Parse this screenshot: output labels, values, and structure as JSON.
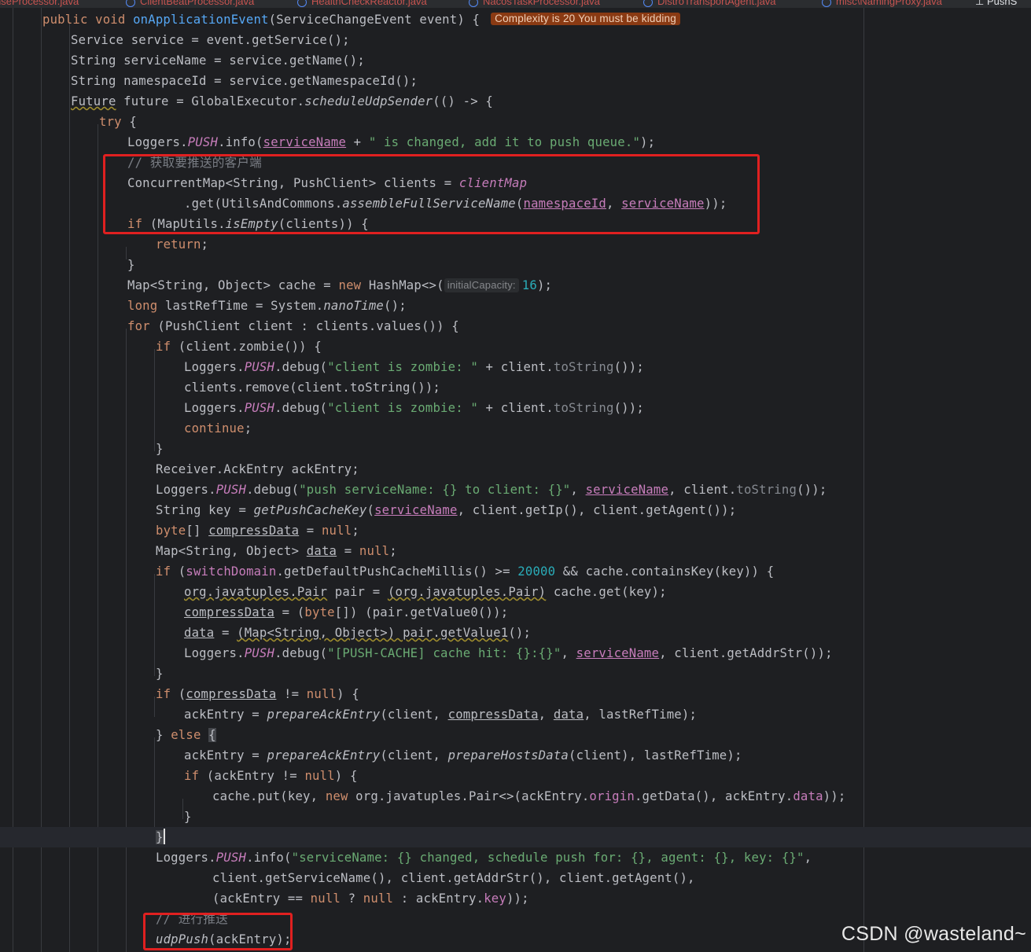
{
  "tabs": [
    {
      "label": "nseProcessor.java"
    },
    {
      "label": "ClientBeatProcessor.java"
    },
    {
      "label": "HealthCheckReactor.java"
    },
    {
      "label": "NacosTaskProcessor.java"
    },
    {
      "label": "DistroTransportAgent.java"
    },
    {
      "label": "misc\\NamingProxy.java"
    },
    {
      "label": "PushS"
    }
  ],
  "complexity_badge": "Complexity is 20 You must be kidding",
  "param_hint": "initialCapacity:",
  "comments": {
    "get_clients": "// 获取要推送的客户端",
    "do_push": "// 进行推送"
  },
  "watermark": "CSDN @wasteland~"
}
